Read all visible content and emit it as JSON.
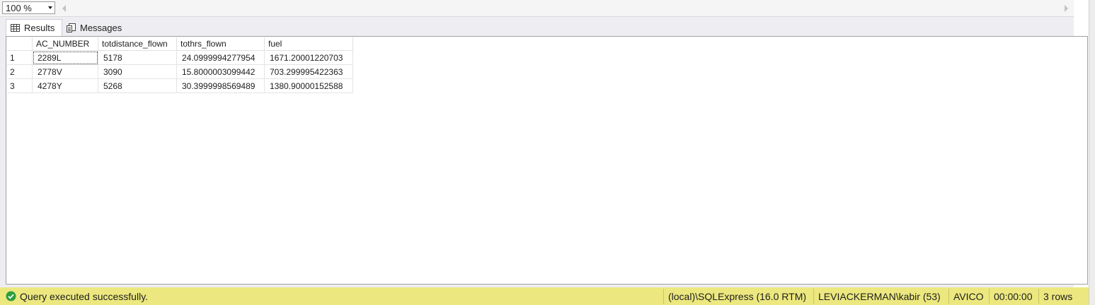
{
  "toolbar": {
    "zoom_value": "100 %"
  },
  "tabs": [
    {
      "label": "Results",
      "icon": "grid-icon",
      "active": true
    },
    {
      "label": "Messages",
      "icon": "messages-icon",
      "active": false
    }
  ],
  "results": {
    "columns": [
      "AC_NUMBER",
      "totdistance_flown",
      "tothrs_flown",
      "fuel"
    ],
    "rows": [
      {
        "num": "1",
        "cells": [
          "2289L",
          "5178",
          "24.0999994277954",
          "1671.20001220703"
        ]
      },
      {
        "num": "2",
        "cells": [
          "2778V",
          "3090",
          "15.8000003099442",
          "703.299995422363"
        ]
      },
      {
        "num": "3",
        "cells": [
          "4278Y",
          "5268",
          "30.3999998569489",
          "1380.90000152588"
        ]
      }
    ]
  },
  "status": {
    "message": "Query executed successfully.",
    "server": "(local)\\SQLExpress (16.0 RTM)",
    "user": "LEVIACKERMAN\\kabir (53)",
    "database": "AVICO",
    "elapsed": "00:00:00",
    "row_count": "3 rows",
    "bar_color": "#ece87f",
    "success_color": "#2e9e3c"
  }
}
